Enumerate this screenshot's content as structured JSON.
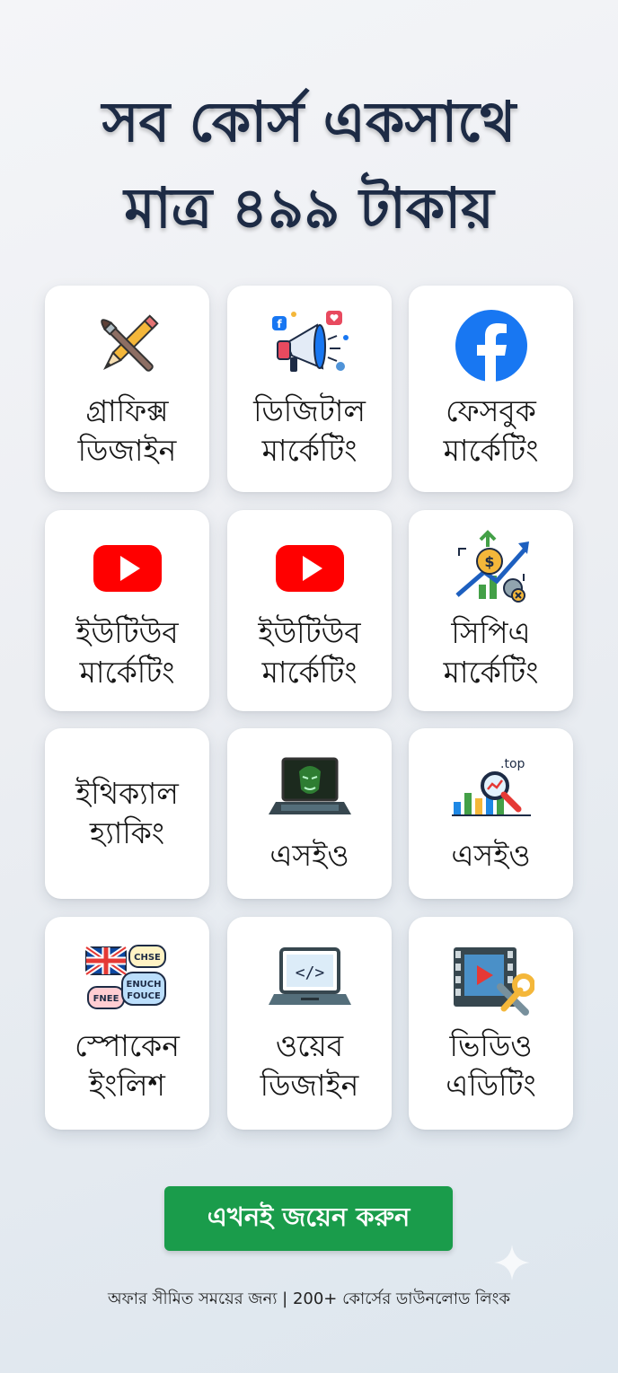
{
  "headline": {
    "line1": "সব কোর্স একসাথে",
    "line2": "মাত্র ৪৯৯ টাকায়"
  },
  "courses": [
    {
      "label": "গ্রাফিক্স\nডিজাইন",
      "icon": "pencil-brush-icon"
    },
    {
      "label": "ডিজিটাল\nমার্কেটিং",
      "icon": "megaphone-icon"
    },
    {
      "label": "ফেসবুক\nমার্কেটিং",
      "icon": "facebook-icon"
    },
    {
      "label": "ইউটিউব\nমার্কেটিং",
      "icon": "youtube-icon"
    },
    {
      "label": "ইউটিউব\nমার্কেটিং",
      "icon": "youtube-icon"
    },
    {
      "label": "সিপিএ\nমার্কেটিং",
      "icon": "growth-chart-icon"
    },
    {
      "label": "ইথিক্যাল\nহ্যাকিং",
      "icon": ""
    },
    {
      "label": "এসইও",
      "icon": "hacker-laptop-icon"
    },
    {
      "label": "এসইও",
      "icon": "seo-chart-icon",
      "icon_text": ".top"
    },
    {
      "label": "স্পোকেন\nইংলিশ",
      "icon": "language-bubbles-icon",
      "icon_texts": [
        "CHSE",
        "ENUCH",
        "FOUCE",
        "FNEE"
      ]
    },
    {
      "label": "ওয়েব\nডিজাইন",
      "icon": "code-laptop-icon"
    },
    {
      "label": "ভিডিও\nএডিটিং",
      "icon": "video-editing-icon"
    }
  ],
  "cta": {
    "label": "এখনই জয়েন করুন"
  },
  "footer": {
    "text": "অফার সীমিত সময়ের জন্য | 200+ কোর্সের ডাউনলোড লিংক"
  },
  "colors": {
    "headline": "#1d2b45",
    "cta": "#1a9c4b",
    "youtube": "#ff0000",
    "facebook": "#1877f2"
  }
}
